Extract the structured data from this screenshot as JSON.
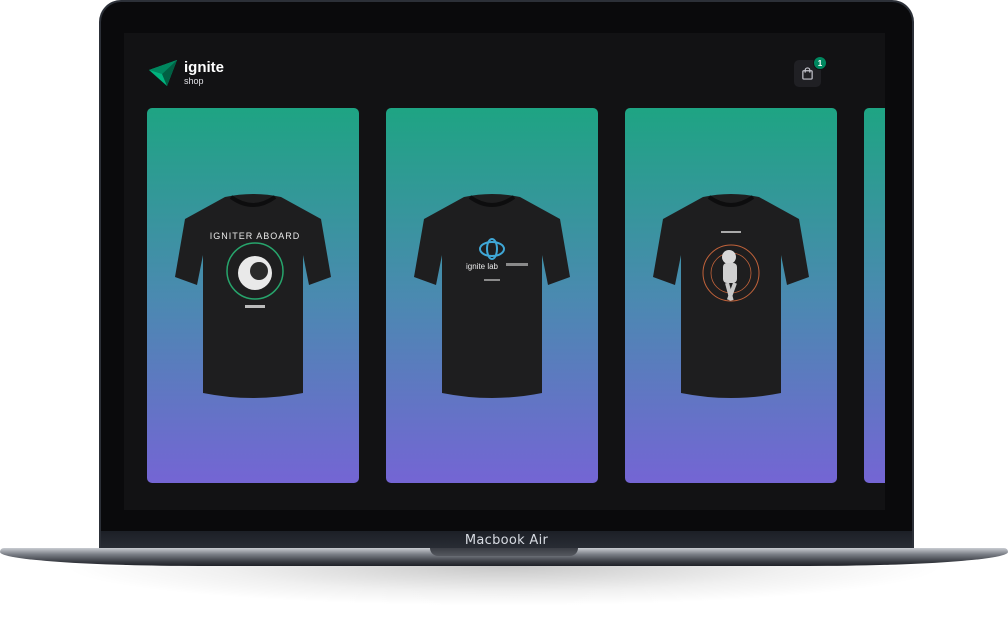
{
  "device": {
    "model_label": "Macbook Air"
  },
  "header": {
    "brand": "ignite",
    "brand_sub": "shop"
  },
  "cart": {
    "count": "1"
  },
  "colors": {
    "screen_bg": "#121214",
    "brand_green": "#00875f",
    "card_gradient_top": "#1ea483",
    "card_gradient_bottom": "#7465d4"
  },
  "products": [
    {
      "icon": "tshirt-igniter-aboard-icon",
      "print": "IGNITER ABOARD"
    },
    {
      "icon": "tshirt-ignite-lab-icon",
      "print": "ignite lab"
    },
    {
      "icon": "tshirt-astronaut-icon",
      "print": ""
    },
    {
      "icon": "tshirt-partial-icon",
      "print": ""
    }
  ]
}
